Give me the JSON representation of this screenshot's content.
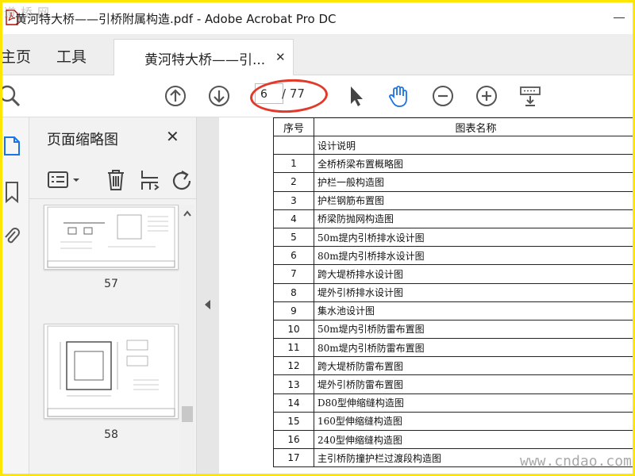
{
  "window": {
    "title": "黄河特大桥——引桥附属构造.pdf - Adobe Acrobat Pro DC",
    "watermark_top": "道桥网"
  },
  "tabs": {
    "home": "主页",
    "tools": "工具",
    "document": "黄河特大桥——引...",
    "close_glyph": "✕"
  },
  "toolbar": {
    "current_page": "6",
    "total_pages": "/ 77",
    "annotation_color": "#e23a2a"
  },
  "thumbnail_panel": {
    "title": "页面缩略图",
    "close_glyph": "✕",
    "pages": [
      {
        "number": "57"
      },
      {
        "number": "58"
      }
    ]
  },
  "document": {
    "table_headers": [
      "序号",
      "图表名称"
    ],
    "rows": [
      {
        "no": "",
        "name": "设计说明"
      },
      {
        "no": "1",
        "name": "全桥桥梁布置概略图"
      },
      {
        "no": "2",
        "name": "护栏一般构造图"
      },
      {
        "no": "3",
        "name": "护栏钢筋布置图"
      },
      {
        "no": "4",
        "name": "桥梁防抛网构造图"
      },
      {
        "no": "5",
        "name": "50m提内引桥排水设计图"
      },
      {
        "no": "6",
        "name": "80m提内引桥排水设计图"
      },
      {
        "no": "7",
        "name": "跨大堤桥排水设计图"
      },
      {
        "no": "8",
        "name": "堤外引桥排水设计图"
      },
      {
        "no": "9",
        "name": "集水池设计图"
      },
      {
        "no": "10",
        "name": "50m堤内引桥防雷布置图"
      },
      {
        "no": "11",
        "name": "80m堤内引桥防雷布置图"
      },
      {
        "no": "12",
        "name": "跨大堤桥防雷布置图"
      },
      {
        "no": "13",
        "name": "堤外引桥防雷布置图"
      },
      {
        "no": "14",
        "name": "D80型伸缩缝构造图"
      },
      {
        "no": "15",
        "name": "160型伸缩缝构造图"
      },
      {
        "no": "16",
        "name": "240型伸缩缝构造图"
      },
      {
        "no": "17",
        "name": "主引桥防撞护栏过渡段构造图"
      }
    ]
  },
  "watermark_bottom": "www.cndao.com",
  "colors": {
    "frame": "#ffe600",
    "accent_blue": "#1a73e8"
  }
}
